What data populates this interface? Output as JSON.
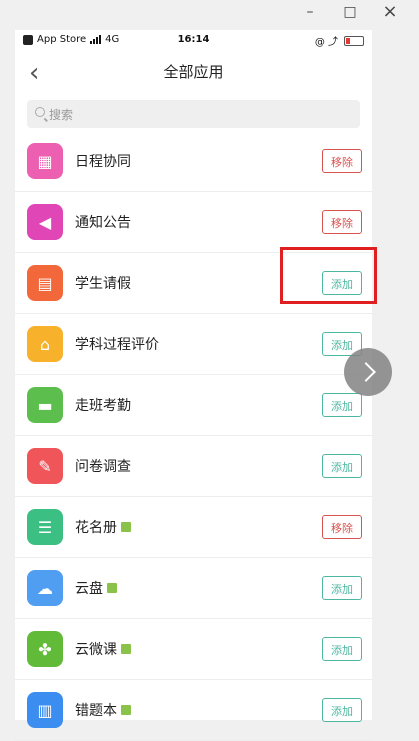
{
  "window": {
    "minimize": "–",
    "maximize": "□",
    "close": "×"
  },
  "status": {
    "carrier": "App Store",
    "network": "4G",
    "time": "16:14",
    "icons": "@ ⤴"
  },
  "nav": {
    "title": "全部应用",
    "back": "‹"
  },
  "search": {
    "placeholder": "搜索"
  },
  "apps": [
    {
      "name": "日程协同",
      "action": "移除",
      "state": "remove",
      "color": "#ec5fb1",
      "icon": "calendar-icon",
      "glyph": "▦",
      "tag": false
    },
    {
      "name": "通知公告",
      "action": "移除",
      "state": "remove",
      "color": "#e046b5",
      "icon": "megaphone-icon",
      "glyph": "◀",
      "tag": false
    },
    {
      "name": "学生请假",
      "action": "添加",
      "state": "add",
      "color": "#f2683a",
      "icon": "leave-form-icon",
      "glyph": "▤",
      "tag": false
    },
    {
      "name": "学科过程评价",
      "action": "添加",
      "state": "add",
      "color": "#f7b12b",
      "icon": "house-icon",
      "glyph": "⌂",
      "tag": false
    },
    {
      "name": "走班考勤",
      "action": "添加",
      "state": "add",
      "color": "#5cbf4d",
      "icon": "attendance-icon",
      "glyph": "▬",
      "tag": false
    },
    {
      "name": "问卷调查",
      "action": "添加",
      "state": "add",
      "color": "#f0555a",
      "icon": "survey-icon",
      "glyph": "✎",
      "tag": false
    },
    {
      "name": "花名册",
      "action": "移除",
      "state": "remove",
      "color": "#3cbf82",
      "icon": "roster-icon",
      "glyph": "☰",
      "tag": true
    },
    {
      "name": "云盘",
      "action": "添加",
      "state": "add",
      "color": "#4f9ef2",
      "icon": "cloud-icon",
      "glyph": "☁",
      "tag": true
    },
    {
      "name": "云微课",
      "action": "添加",
      "state": "add",
      "color": "#62bb38",
      "icon": "film-reel-icon",
      "glyph": "✤",
      "tag": true
    },
    {
      "name": "错题本",
      "action": "添加",
      "state": "add",
      "color": "#3b8ef0",
      "icon": "notebook-icon",
      "glyph": "▥",
      "tag": true
    }
  ],
  "colors": {
    "remove": "#d9534f",
    "add": "#4db6a0",
    "highlight": "#e02020"
  }
}
